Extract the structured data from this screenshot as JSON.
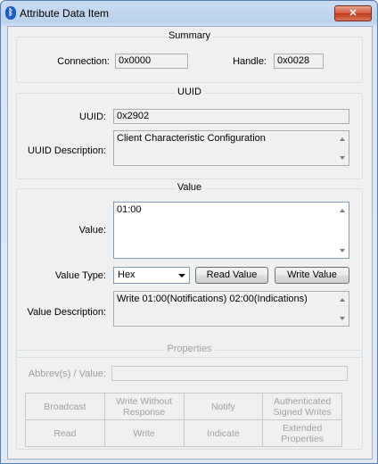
{
  "window": {
    "title": "Attribute Data Item",
    "close_label": "✕"
  },
  "summary": {
    "title": "Summary",
    "connection_label": "Connection:",
    "connection_value": "0x0000",
    "handle_label": "Handle:",
    "handle_value": "0x0028"
  },
  "uuid": {
    "title": "UUID",
    "uuid_label": "UUID:",
    "uuid_value": "0x2902",
    "description_label": "UUID Description:",
    "description_value": "Client Characteristic Configuration"
  },
  "value": {
    "title": "Value",
    "value_label": "Value:",
    "value_text": "01:00",
    "type_label": "Value Type:",
    "type_selected": "Hex",
    "read_button": "Read Value",
    "write_button": "Write Value",
    "description_label": "Value Description:",
    "description_value": "Write 01:00(Notifications) 02:00(Indications)"
  },
  "properties": {
    "title": "Properties",
    "abbrev_label": "Abbrev(s) / Value:",
    "abbrev_value": "",
    "cells": [
      [
        "Broadcast",
        "Write Without Response",
        "Notify",
        "Authenticated Signed Writes"
      ],
      [
        "Read",
        "Write",
        "Indicate",
        "Extended Properties"
      ]
    ]
  }
}
